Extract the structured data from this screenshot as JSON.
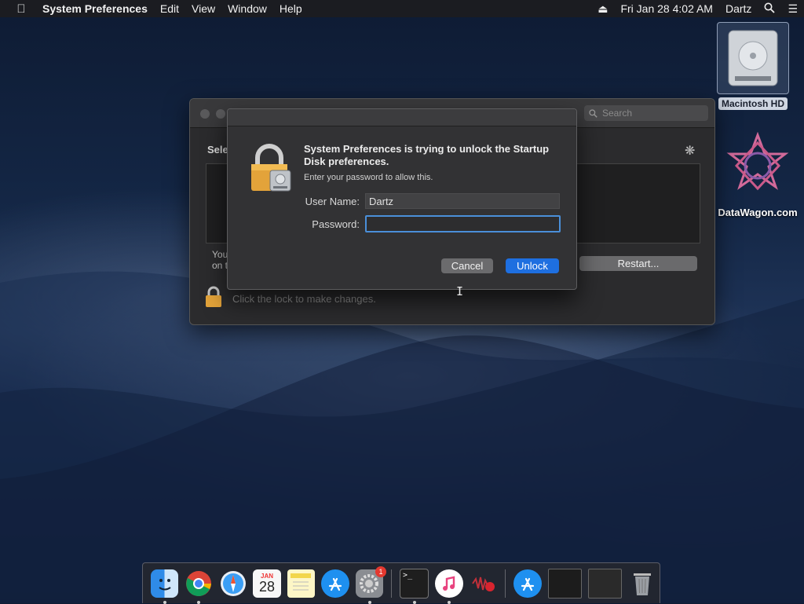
{
  "menubar": {
    "apple_icon": "apple-icon",
    "app_name": "System Preferences",
    "menus": [
      "Edit",
      "View",
      "Window",
      "Help"
    ],
    "date_time": "Fri Jan 28  4:02 AM",
    "user": "Dartz"
  },
  "desktop": {
    "hd_label": "Macintosh HD",
    "datawagon_label": "DataWagon.com"
  },
  "pref_window": {
    "search_placeholder": "Search",
    "heading_fragment": "Sele",
    "note_fragment_1": "You",
    "note_fragment_2": "on t",
    "restart_label": "Restart...",
    "lock_text": "Click the lock to make changes."
  },
  "dialog": {
    "title": "System Preferences is trying to unlock the Startup Disk preferences.",
    "subtitle": "Enter your password to allow this.",
    "username_label": "User Name:",
    "username_value": "Dartz",
    "password_label": "Password:",
    "password_value": "",
    "cancel_label": "Cancel",
    "unlock_label": "Unlock"
  },
  "dock": {
    "calendar_month": "JAN",
    "calendar_day": "28",
    "app_store_badge": "1",
    "terminal_prompt": ">_"
  },
  "colors": {
    "accent": "#1e6fe0",
    "focus_ring": "#4a8fd9",
    "lock_gold": "#e3a33a"
  }
}
